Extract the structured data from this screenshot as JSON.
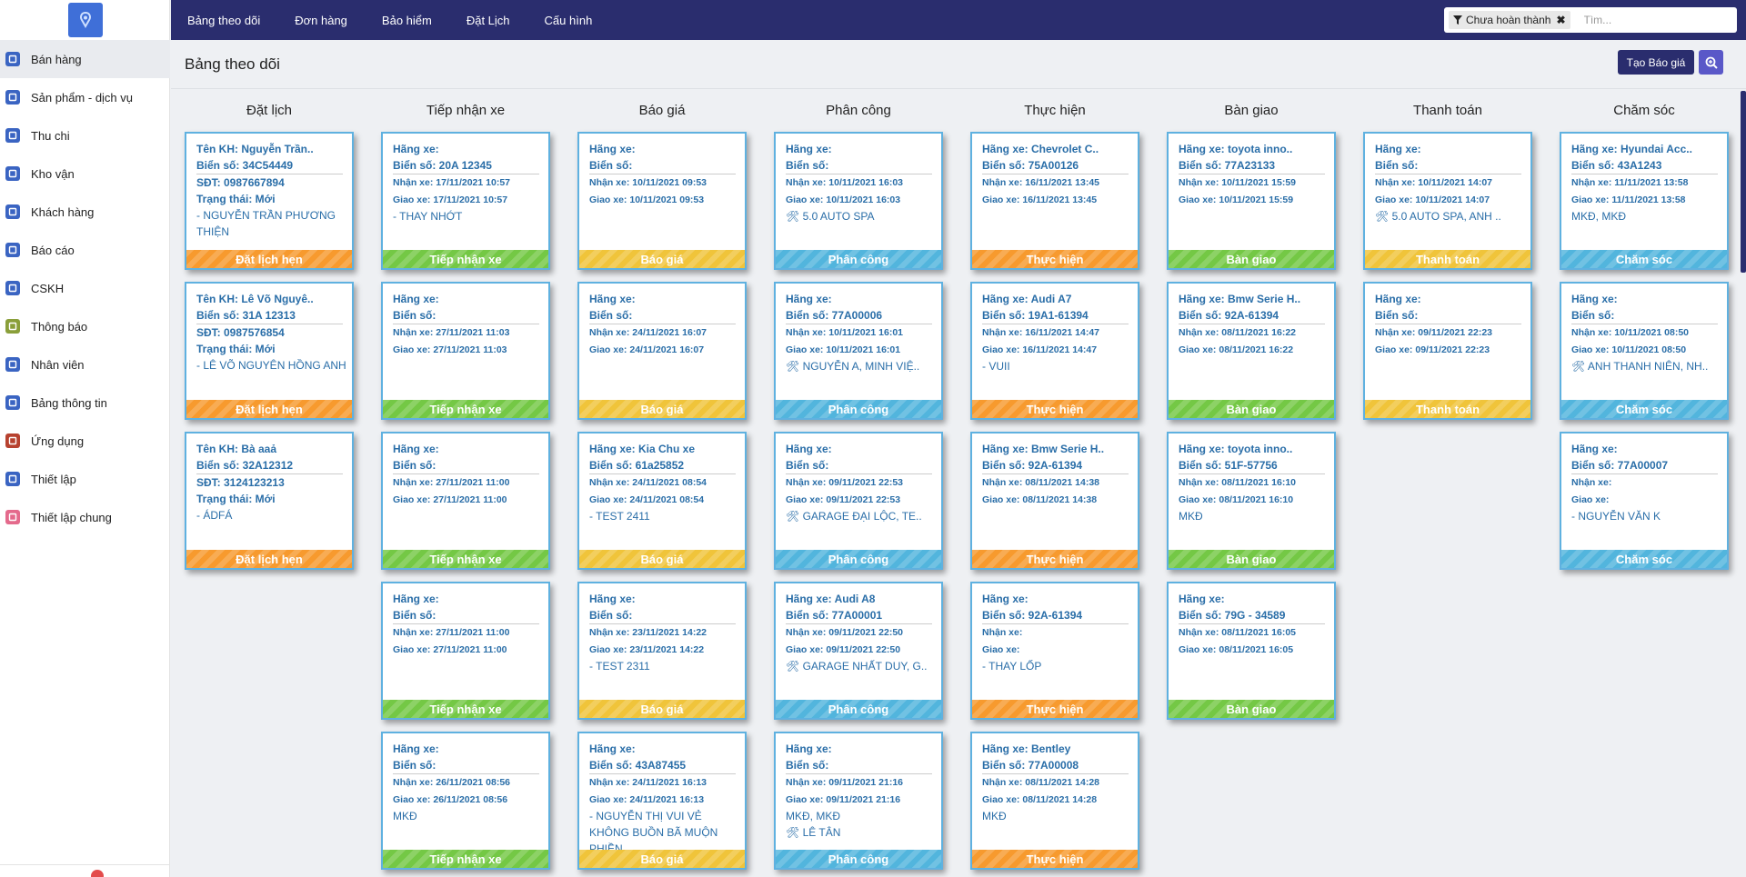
{
  "colors": {
    "orange": "#f79a2e",
    "green": "#74c845",
    "yellow": "#f0c43a",
    "blue": "#52b5dd"
  },
  "sidebar": {
    "items": [
      {
        "label": "Bán hàng",
        "icon": "store-icon",
        "color": "#3a64c2",
        "active": true
      },
      {
        "label": "Sản phẩm - dịch vụ",
        "icon": "product-icon",
        "color": "#3a64c2"
      },
      {
        "label": "Thu chi",
        "icon": "money-icon",
        "color": "#3a64c2"
      },
      {
        "label": "Kho vận",
        "icon": "warehouse-icon",
        "color": "#3a64c2"
      },
      {
        "label": "Khách hàng",
        "icon": "customer-icon",
        "color": "#3a64c2"
      },
      {
        "label": "Báo cáo",
        "icon": "report-icon",
        "color": "#3a64c2"
      },
      {
        "label": "CSKH",
        "icon": "support-icon",
        "color": "#3a64c2"
      },
      {
        "label": "Thông báo",
        "icon": "notification-icon",
        "color": "#8a9f3a"
      },
      {
        "label": "Nhân viên",
        "icon": "staff-icon",
        "color": "#3a64c2"
      },
      {
        "label": "Bảng thông tin",
        "icon": "info-board-icon",
        "color": "#3a64c2"
      },
      {
        "label": "Ứng dụng",
        "icon": "apps-icon",
        "color": "#b7422f"
      },
      {
        "label": "Thiết lập",
        "icon": "settings-icon",
        "color": "#3a64c2"
      },
      {
        "label": "Thiết lập chung",
        "icon": "general-settings-icon",
        "color": "#e46a8c"
      }
    ]
  },
  "topnav": {
    "links": [
      "Bảng theo dõi",
      "Đơn hàng",
      "Bảo hiểm",
      "Đặt Lịch",
      "Cấu hình"
    ],
    "filter_label": "Chưa hoàn thành",
    "search_placeholder": "Tìm..."
  },
  "main": {
    "title": "Bảng theo dõi",
    "create_button": "Tạo Báo giá"
  },
  "columns": [
    {
      "title": "Đặt lịch",
      "status": "Đặt lịch hẹn",
      "color": "orange",
      "cards": [
        {
          "lines": [
            "Tên KH: Nguyễn Trần..",
            "Biển số: 34C54449",
            "SĐT: 0987667894",
            "Trạng thái: Mới"
          ],
          "note": "- NGUYỄN TRẦN PHƯƠNG THIỆN"
        },
        {
          "lines": [
            "Tên KH: Lê Võ Nguyê..",
            "Biển số: 31A 12313",
            "SĐT: 0987576854",
            "Trạng thái: Mới"
          ],
          "note": "- LÊ VÕ NGUYÊN HỒNG ANH"
        },
        {
          "lines": [
            "Tên KH: Bà aaả",
            "Biển số: 32A12312",
            "SĐT: 3124123213",
            "Trạng thái: Mới"
          ],
          "note": "- ÁDFÁ"
        }
      ]
    },
    {
      "title": "Tiếp nhận xe",
      "status": "Tiếp nhận xe",
      "color": "green",
      "cards": [
        {
          "lines": [
            "Hãng xe:",
            "Biển số: 20A 12345",
            "Nhận xe: 17/11/2021 10:57",
            "Giao xe: 17/11/2021 10:57"
          ],
          "note": "- THAY NHỚT"
        },
        {
          "lines": [
            "Hãng xe:",
            "Biển số:",
            "Nhận xe: 27/11/2021 11:03",
            "Giao xe: 27/11/2021 11:03"
          ],
          "note": ""
        },
        {
          "lines": [
            "Hãng xe:",
            "Biển số:",
            "Nhận xe: 27/11/2021 11:00",
            "Giao xe: 27/11/2021 11:00"
          ],
          "note": ""
        },
        {
          "lines": [
            "Hãng xe:",
            "Biển số:",
            "Nhận xe: 27/11/2021 11:00",
            "Giao xe: 27/11/2021 11:00"
          ],
          "note": ""
        },
        {
          "lines": [
            "Hãng xe:",
            "Biển số:",
            "Nhận xe: 26/11/2021 08:56",
            "Giao xe: 26/11/2021 08:56"
          ],
          "note": "MKĐ"
        }
      ]
    },
    {
      "title": "Báo giá",
      "status": "Báo giá",
      "color": "yellow",
      "cards": [
        {
          "lines": [
            "Hãng xe:",
            "Biển số:",
            "Nhận xe: 10/11/2021 09:53",
            "Giao xe: 10/11/2021 09:53"
          ],
          "note": ""
        },
        {
          "lines": [
            "Hãng xe:",
            "Biển số:",
            "Nhận xe: 24/11/2021 16:07",
            "Giao xe: 24/11/2021 16:07"
          ],
          "note": ""
        },
        {
          "lines": [
            "Hãng xe: Kia Chu xe",
            "Biển số: 61a25852",
            "Nhận xe: 24/11/2021 08:54",
            "Giao xe: 24/11/2021 08:54"
          ],
          "note": "- TEST 2411"
        },
        {
          "lines": [
            "Hãng xe:",
            "Biển số:",
            "Nhận xe: 23/11/2021 14:22",
            "Giao xe: 23/11/2021 14:22"
          ],
          "note": "- TEST 2311"
        },
        {
          "lines": [
            "Hãng xe:",
            "Biển số: 43A87455",
            "Nhận xe: 24/11/2021 16:13",
            "Giao xe: 24/11/2021 16:13"
          ],
          "note": "- NGUYỄN THỊ VUI VẺ KHÔNG BUỒN BÃ MUỘN PHIỀN"
        }
      ]
    },
    {
      "title": "Phân công",
      "status": "Phân công",
      "color": "blue",
      "cards": [
        {
          "lines": [
            "Hãng xe:",
            "Biển số:",
            "Nhận xe: 10/11/2021 16:03",
            "Giao xe: 10/11/2021 16:03"
          ],
          "note": "🛠 5.0 AUTO SPA"
        },
        {
          "lines": [
            "Hãng xe:",
            "Biển số: 77A00006",
            "Nhận xe: 10/11/2021 16:01",
            "Giao xe: 10/11/2021 16:01"
          ],
          "note": "🛠 NGUYỄN A, MINH VIỆ.."
        },
        {
          "lines": [
            "Hãng xe:",
            "Biển số:",
            "Nhận xe: 09/11/2021 22:53",
            "Giao xe: 09/11/2021 22:53"
          ],
          "note": "🛠 GARAGE ĐẠI LỘC, TE.."
        },
        {
          "lines": [
            "Hãng xe: Audi A8",
            "Biển số: 77A00001",
            "Nhận xe: 09/11/2021 22:50",
            "Giao xe: 09/11/2021 22:50"
          ],
          "note": "🛠 GARAGE NHẤT DUY, G.."
        },
        {
          "lines": [
            "Hãng xe:",
            "Biển số:",
            "Nhận xe: 09/11/2021 21:16",
            "Giao xe: 09/11/2021 21:16"
          ],
          "note": "MKĐ, MKĐ",
          "note2": "🛠 LÊ TÂN"
        }
      ]
    },
    {
      "title": "Thực hiện",
      "status": "Thực hiện",
      "color": "orange",
      "cards": [
        {
          "lines": [
            "Hãng xe: Chevrolet C..",
            "Biển số: 75A00126",
            "Nhận xe: 16/11/2021 13:45",
            "Giao xe: 16/11/2021 13:45"
          ],
          "note": ""
        },
        {
          "lines": [
            "Hãng xe: Audi A7",
            "Biển số: 19A1-61394",
            "Nhận xe: 16/11/2021 14:47",
            "Giao xe: 16/11/2021 14:47"
          ],
          "note": "- VUII"
        },
        {
          "lines": [
            "Hãng xe: Bmw Serie H..",
            "Biển số: 92A-61394",
            "Nhận xe: 08/11/2021 14:38",
            "Giao xe: 08/11/2021 14:38"
          ],
          "note": ""
        },
        {
          "lines": [
            "Hãng xe:",
            "Biển số: 92A-61394",
            "Nhận xe:",
            "Giao xe:"
          ],
          "note": "- THAY LỐP"
        },
        {
          "lines": [
            "Hãng xe: Bentley",
            "Biển số: 77A00008",
            "Nhận xe: 08/11/2021 14:28",
            "Giao xe: 08/11/2021 14:28"
          ],
          "note": "MKĐ"
        }
      ]
    },
    {
      "title": "Bàn giao",
      "status": "Bàn giao",
      "color": "green",
      "cards": [
        {
          "lines": [
            "Hãng xe: toyota inno..",
            "Biển số: 77A23133",
            "Nhận xe: 10/11/2021 15:59",
            "Giao xe: 10/11/2021 15:59"
          ],
          "note": ""
        },
        {
          "lines": [
            "Hãng xe: Bmw Serie H..",
            "Biển số: 92A-61394",
            "Nhận xe: 08/11/2021 16:22",
            "Giao xe: 08/11/2021 16:22"
          ],
          "note": ""
        },
        {
          "lines": [
            "Hãng xe: toyota inno..",
            "Biển số: 51F-57756",
            "Nhận xe: 08/11/2021 16:10",
            "Giao xe: 08/11/2021 16:10"
          ],
          "note": "MKĐ"
        },
        {
          "lines": [
            "Hãng xe:",
            "Biển số: 79G - 34589",
            "Nhận xe: 08/11/2021 16:05",
            "Giao xe: 08/11/2021 16:05"
          ],
          "note": ""
        }
      ]
    },
    {
      "title": "Thanh toán",
      "status": "Thanh toán",
      "color": "yellow",
      "cards": [
        {
          "lines": [
            "Hãng xe:",
            "Biển số:",
            "Nhận xe: 10/11/2021 14:07",
            "Giao xe: 10/11/2021 14:07"
          ],
          "note": "🛠 5.0 AUTO SPA, ANH .."
        },
        {
          "lines": [
            "Hãng xe:",
            "Biển số:",
            "Nhận xe: 09/11/2021 22:23",
            "Giao xe: 09/11/2021 22:23"
          ],
          "note": ""
        }
      ]
    },
    {
      "title": "Chăm sóc",
      "status": "Chăm sóc",
      "color": "blue",
      "cards": [
        {
          "lines": [
            "Hãng xe: Hyundai Acc..",
            "Biển số: 43A1243",
            "Nhận xe: 11/11/2021 13:58",
            "Giao xe: 11/11/2021 13:58"
          ],
          "note": "MKĐ, MKĐ"
        },
        {
          "lines": [
            "Hãng xe:",
            "Biển số:",
            "Nhận xe: 10/11/2021 08:50",
            "Giao xe: 10/11/2021 08:50"
          ],
          "note": "🛠 ANH THANH NIÊN, NH.."
        },
        {
          "lines": [
            "Hãng xe:",
            "Biển số: 77A00007",
            "Nhận xe:",
            "Giao xe:"
          ],
          "note": "- NGUYỄN VĂN K"
        }
      ]
    }
  ]
}
